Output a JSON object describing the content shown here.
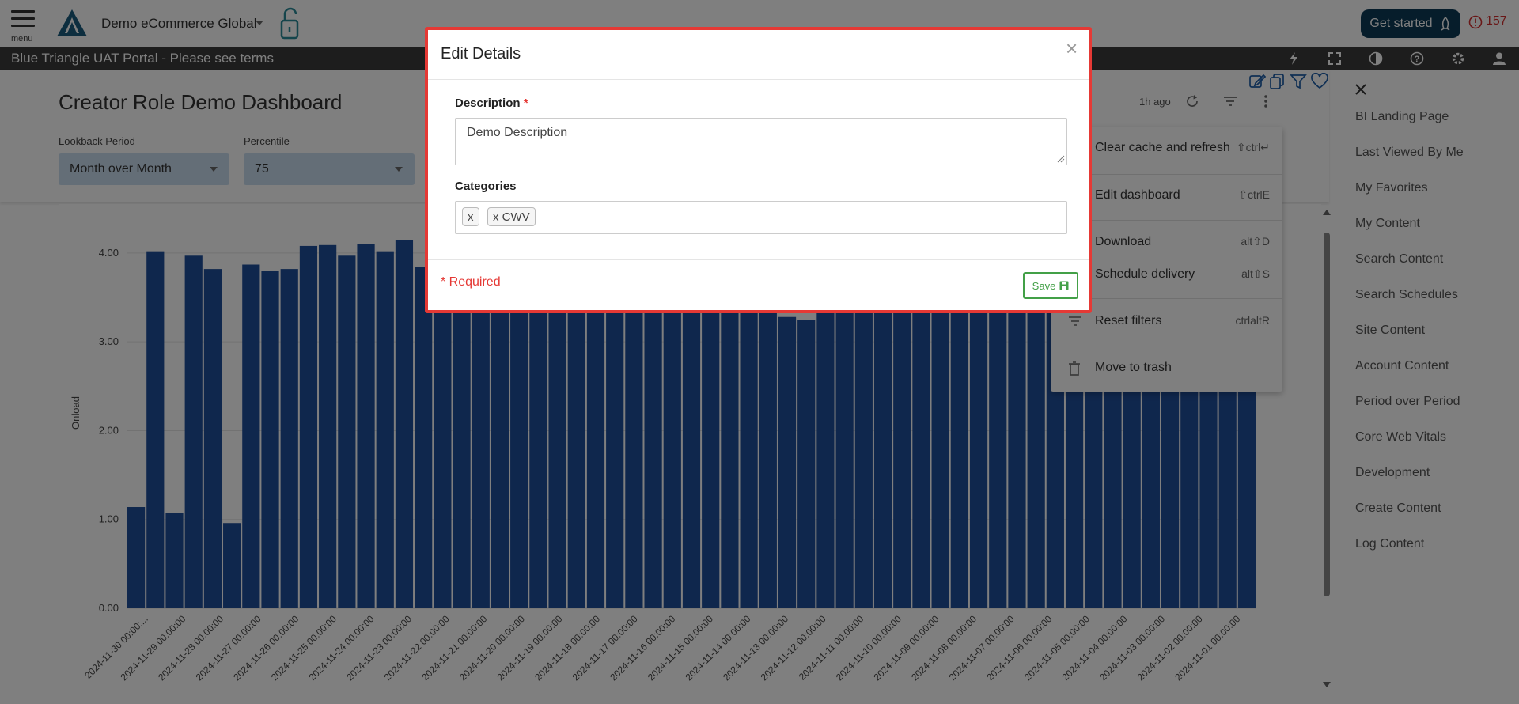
{
  "topbar": {
    "menu_label": "menu",
    "org_name": "Demo eCommerce Global",
    "get_started": "Get started",
    "alert_count": "157"
  },
  "darkbar": {
    "portal_title": "Blue Triangle UAT Portal - Please see terms"
  },
  "dashboard": {
    "title": "Creator Role Demo Dashboard",
    "updated": "1h ago",
    "filters": [
      {
        "label": "Lookback Period",
        "value": "Month over Month"
      },
      {
        "label": "Percentile",
        "value": "75"
      }
    ]
  },
  "chart_data": {
    "type": "bar",
    "ylabel": "Onload",
    "ylim": [
      0,
      4.4
    ],
    "yticks": [
      "0.00",
      "1.00",
      "2.00",
      "3.00",
      "4.00"
    ],
    "color": "#1f4e9a",
    "categories": [
      "2024-11-30 00:00:...",
      "2024-11-29 00:00:00",
      "2024-11-28 00:00:00",
      "2024-11-27 00:00:00",
      "2024-11-26 00:00:00",
      "2024-11-25 00:00:00",
      "2024-11-24 00:00:00",
      "2024-11-23 00:00:00",
      "2024-11-22 00:00:00",
      "2024-11-21 00:00:00",
      "2024-11-20 00:00:00",
      "2024-11-19 00:00:00",
      "2024-11-18 00:00:00",
      "2024-11-17 00:00:00",
      "2024-11-16 00:00:00",
      "2024-11-15 00:00:00",
      "2024-11-14 00:00:00",
      "2024-11-13 00:00:00",
      "2024-11-12 00:00:00",
      "2024-11-11 00:00:00",
      "2024-11-10 00:00:00",
      "2024-11-09 00:00:00",
      "2024-11-08 00:00:00",
      "2024-11-07 00:00:00",
      "2024-11-06 00:00:00",
      "2024-11-05 00:00:00",
      "2024-11-04 00:00:00",
      "2024-11-03 00:00:00",
      "2024-11-02 00:00:00",
      "2024-11-01 00:00:00"
    ],
    "values": [
      1.14,
      4.02,
      1.07,
      3.97,
      3.82,
      0.96,
      3.87,
      3.8,
      3.82,
      4.08,
      4.09,
      3.97,
      4.1,
      4.02,
      4.15,
      3.84,
      3.75,
      3.72,
      3.8,
      3.74,
      3.76,
      3.78,
      3.74,
      3.76,
      3.79,
      3.7,
      3.73,
      3.75,
      3.74,
      3.46,
      3.72,
      3.75,
      3.74,
      3.76,
      3.28,
      3.25,
      3.74,
      3.76,
      3.4,
      3.73,
      3.75,
      3.74,
      3.78,
      3.76,
      3.74,
      3.75,
      3.77,
      3.74,
      3.76,
      3.75,
      3.74,
      3.76,
      3.75,
      3.74,
      3.76,
      3.74,
      3.75,
      3.74,
      3.75
    ]
  },
  "dropdown_menu": {
    "items": [
      {
        "label": "Clear cache and refresh",
        "shortcut": "⇧ctrl↵"
      },
      {
        "label": "Edit dashboard",
        "shortcut": "⇧ctrlE"
      },
      {
        "label": "Download",
        "shortcut": "alt⇧D"
      },
      {
        "label": "Schedule delivery",
        "shortcut": "alt⇧S"
      },
      {
        "label": "Reset filters",
        "shortcut": "ctrlaltR"
      },
      {
        "label": "Move to trash",
        "shortcut": ""
      }
    ]
  },
  "right_panel": {
    "items": [
      "BI Landing Page",
      "Last Viewed By Me",
      "My Favorites",
      "My Content",
      "Search Content",
      "Search Schedules",
      "Site Content",
      "Account Content",
      "Period over Period",
      "Core Web Vitals",
      "Development",
      "Create Content",
      "Log Content"
    ]
  },
  "modal": {
    "title": "Edit Details",
    "close": "×",
    "description_label": "Description",
    "required_star": "*",
    "description_value": "Demo Description",
    "categories_label": "Categories",
    "tags": [
      "x",
      "x CWV"
    ],
    "required_note": "* Required",
    "save_label": "Save"
  }
}
